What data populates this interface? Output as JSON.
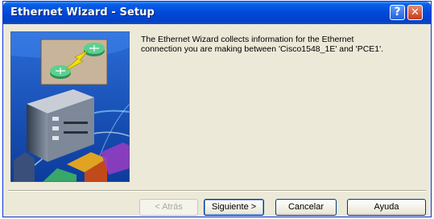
{
  "window": {
    "title": "Ethernet Wizard - Setup"
  },
  "titlebar_buttons": {
    "help_glyph": "?",
    "close_glyph": "✕"
  },
  "description": "The Ethernet Wizard collects information for the Ethernet\nconnection you are making between 'Cisco1548_1E' and 'PCE1'.",
  "buttons": {
    "back": "< Atrás",
    "next": "Siguiente >",
    "cancel": "Cancelar",
    "help": "Ayuda"
  },
  "illustration": {
    "icon": "network-router-connection-illustration"
  },
  "colors": {
    "titlebar": "#0048d8",
    "dialog_bg": "#ece9d8",
    "close": "#c8381a"
  }
}
